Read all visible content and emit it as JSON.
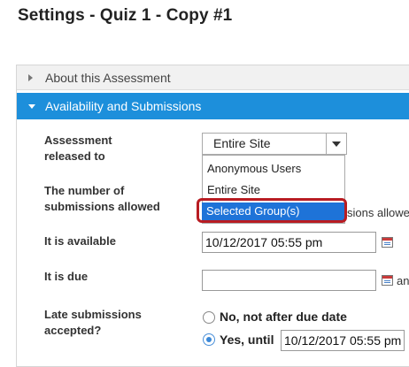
{
  "page": {
    "title": "Settings - Quiz 1 - Copy #1"
  },
  "sections": {
    "about": "About this Assessment",
    "availability": "Availability and Submissions"
  },
  "fields": {
    "released_to": {
      "label_line1": "Assessment",
      "label_line2": "released to",
      "value": "Entire Site",
      "options": [
        "Anonymous Users",
        "Entire Site",
        "Selected Group(s)"
      ],
      "highlighted_option": "Selected Group(s)"
    },
    "submissions": {
      "label_line1": "The number of",
      "label_line2": "submissions allowed",
      "clipped_text": "sions allowe"
    },
    "available": {
      "label": "It is available",
      "value": "10/12/2017 05:55 pm"
    },
    "due": {
      "label": "It is due",
      "value": "",
      "trailing_text": "an"
    },
    "late": {
      "label_line1": "Late submissions",
      "label_line2": "accepted?",
      "option_no": "No, not after due date",
      "option_yes": "Yes, until",
      "yes_value": "10/12/2017 05:55 pm",
      "selected": "yes"
    }
  },
  "colors": {
    "accent": "#1d8fdb",
    "highlight_ring": "#b81c22",
    "selected_option": "#1e73d8"
  }
}
